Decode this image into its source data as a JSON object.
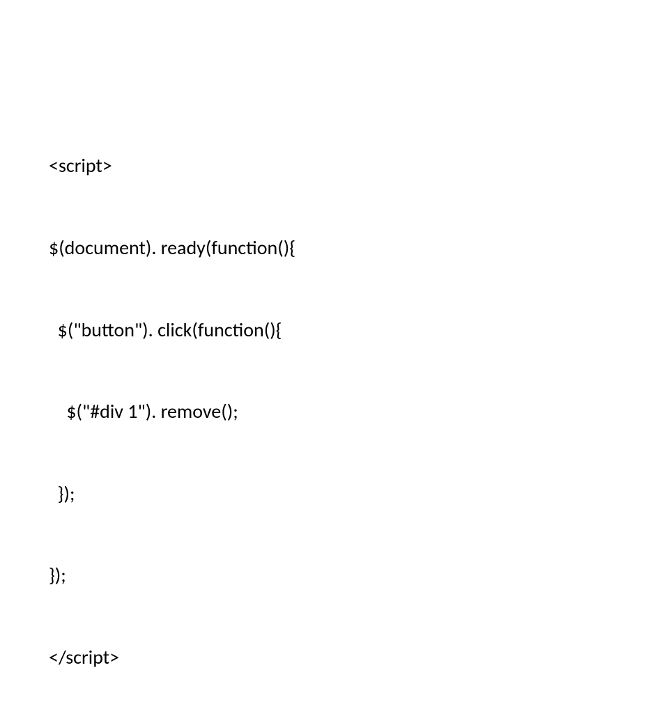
{
  "code": {
    "lines": [
      "<script>",
      "$(document). ready(function(){",
      "  $(\"button\"). click(function(){",
      "    $(\"#div 1\"). remove();",
      "  });",
      "});",
      "</script>"
    ]
  }
}
